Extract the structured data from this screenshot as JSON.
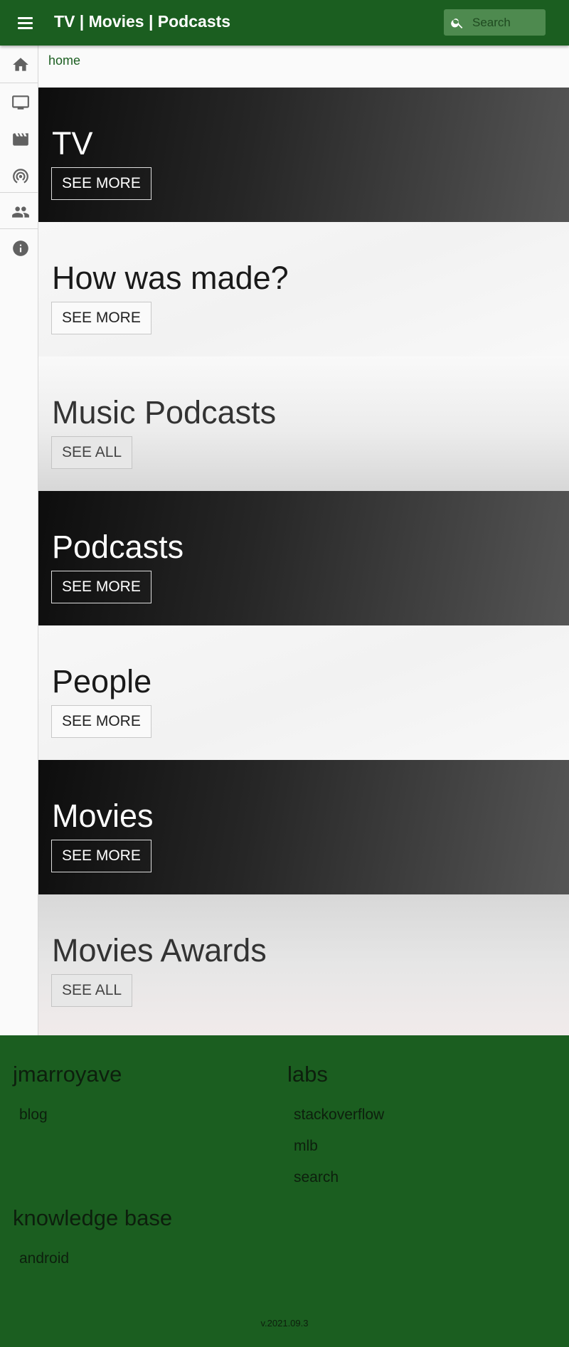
{
  "app": {
    "title": "TV | Movies | Podcasts"
  },
  "search": {
    "placeholder": "Search",
    "value": ""
  },
  "rail": {
    "items": [
      {
        "name": "home",
        "icon": "home-icon"
      },
      {
        "name": "tv",
        "icon": "tv-icon"
      },
      {
        "name": "movies",
        "icon": "movie-clapper-icon"
      },
      {
        "name": "podcasts",
        "icon": "podcast-icon"
      },
      {
        "name": "people",
        "icon": "people-icon"
      },
      {
        "name": "about",
        "icon": "info-icon"
      }
    ]
  },
  "breadcrumb": {
    "home": "home"
  },
  "sections": [
    {
      "title": "TV",
      "cta": "SEE MORE",
      "theme": "dark"
    },
    {
      "title": "How was made?",
      "cta": "SEE MORE",
      "theme": "light"
    },
    {
      "title": "Music Podcasts",
      "cta": "SEE ALL",
      "theme": "grey-down"
    },
    {
      "title": "Podcasts",
      "cta": "SEE MORE",
      "theme": "dark"
    },
    {
      "title": "People",
      "cta": "SEE MORE",
      "theme": "light"
    },
    {
      "title": "Movies",
      "cta": "SEE MORE",
      "theme": "dark"
    },
    {
      "title": "Movies Awards",
      "cta": "SEE ALL",
      "theme": "grey-up"
    }
  ],
  "footer": {
    "columns": [
      {
        "heading": "jmarroyave",
        "links": [
          "blog"
        ]
      },
      {
        "heading": "labs",
        "links": [
          "stackoverflow",
          "mlb",
          "search"
        ]
      },
      {
        "heading": "knowledge base",
        "links": [
          "android"
        ]
      }
    ],
    "version": "v.2021.09.3"
  },
  "colors": {
    "primary": "#1b5e20",
    "search_bg": "#4e8a4f",
    "rail_icon": "#616161"
  }
}
